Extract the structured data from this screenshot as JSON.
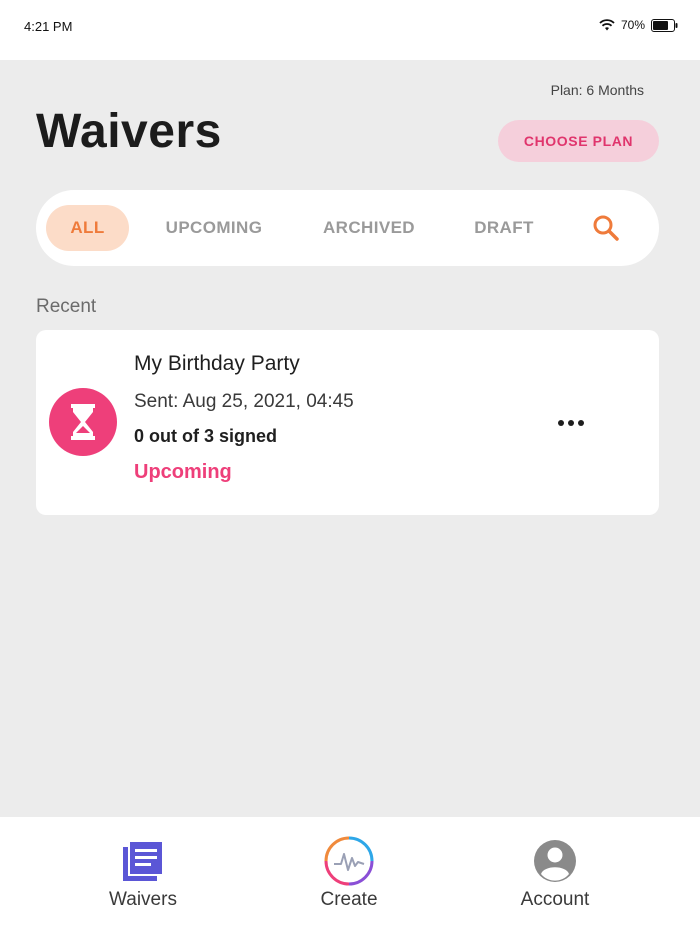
{
  "status_bar": {
    "time": "4:21 PM",
    "battery": "70%",
    "icons": [
      "wifi-icon",
      "battery-icon"
    ]
  },
  "header": {
    "plan": "Plan: 6 Months",
    "title": "Waivers",
    "choose_plan_label": "CHOOSE PLAN"
  },
  "tabs": {
    "items": [
      {
        "label": "ALL",
        "active": true
      },
      {
        "label": "UPCOMING",
        "active": false
      },
      {
        "label": "ARCHIVED",
        "active": false
      },
      {
        "label": "DRAFT",
        "active": false
      }
    ],
    "search_icon": "search-icon"
  },
  "recent": {
    "section_label": "Recent",
    "cards": [
      {
        "title": "My Birthday Party",
        "sent": "Sent: Aug 25, 2021, 04:45",
        "signed": "0 out of 3 signed",
        "status": "Upcoming",
        "icon": "hourglass-icon",
        "more_icon": "more-options-icon"
      }
    ]
  },
  "bottom_nav": {
    "items": [
      {
        "label": "Waivers",
        "icon": "document-list-icon"
      },
      {
        "label": "Create",
        "icon": "signature-icon"
      },
      {
        "label": "Account",
        "icon": "user-icon"
      }
    ]
  },
  "colors": {
    "accent_pink": "#ee3f7a",
    "accent_orange": "#ef7b3b",
    "active_tab_bg": "#fcdcc8",
    "plan_button_bg": "#f5cfdb",
    "nav_waivers_icon": "#5b56d6",
    "background": "#ececec"
  }
}
